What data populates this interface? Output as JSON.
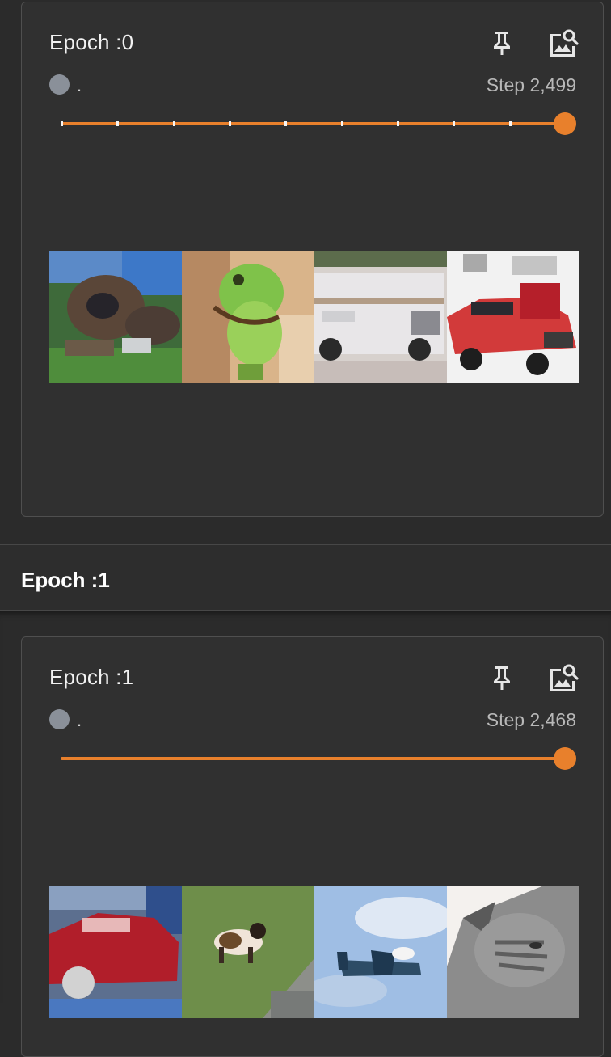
{
  "cards": [
    {
      "title": "Epoch :0",
      "run_label": ".",
      "step_label": "Step 2,499",
      "slider_value": 1.0,
      "images": [
        "dog-photo",
        "frog-photo",
        "truck-photo",
        "red-car-photo"
      ]
    },
    {
      "title": "Epoch :1",
      "run_label": ".",
      "step_label": "Step 2,468",
      "slider_value": 1.0,
      "images": [
        "red-car-photo",
        "dog-photo",
        "airplane-photo",
        "cat-photo"
      ]
    }
  ],
  "group": {
    "title": "Epoch :1"
  },
  "icons": {
    "pin": "pin-icon",
    "zoom": "image-search-icon"
  },
  "colors": {
    "accent": "#e8802c",
    "status_dot": "#8a9099",
    "card_bg": "#303030",
    "page_bg": "#2b2b2b"
  }
}
